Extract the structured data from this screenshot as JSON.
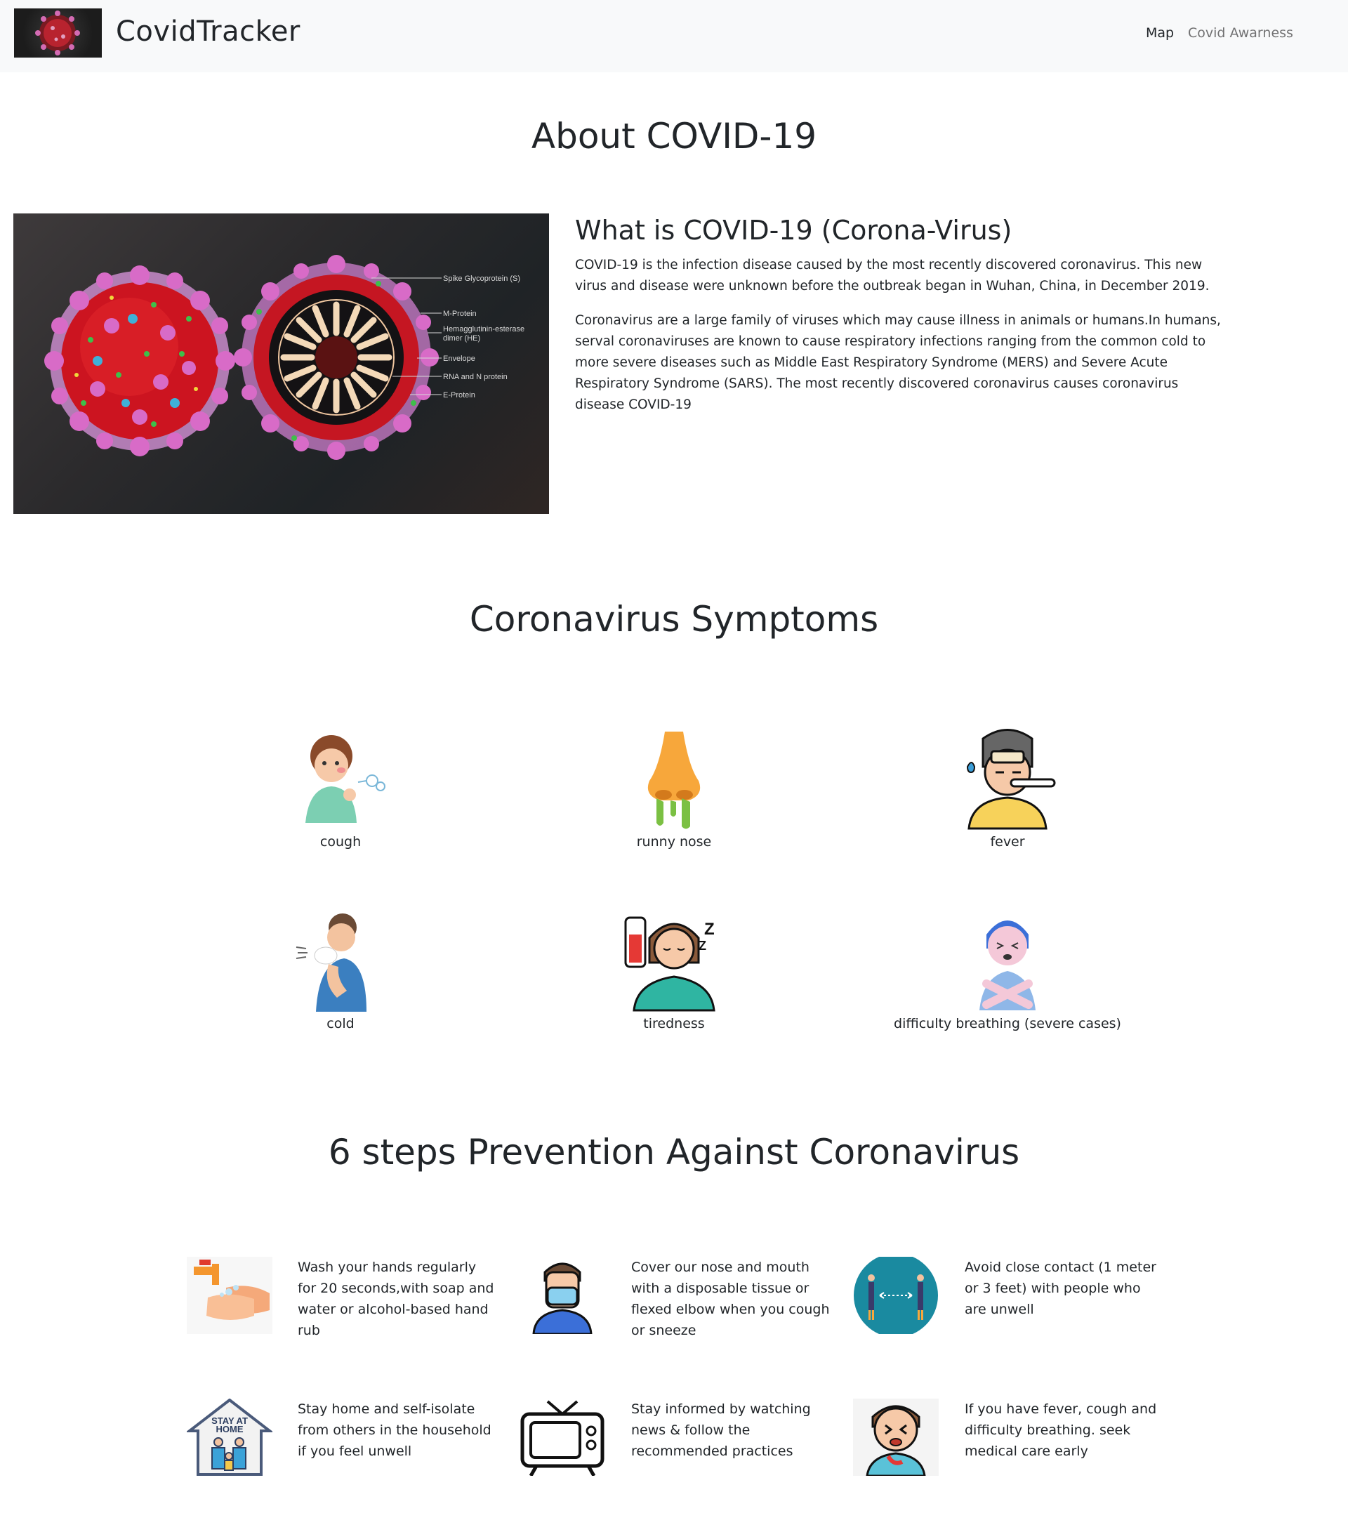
{
  "navbar": {
    "brand": "CovidTracker",
    "links": [
      {
        "label": "Map"
      },
      {
        "label": "Covid Awarness"
      }
    ]
  },
  "about": {
    "heading": "About COVID-19",
    "title": "What is COVID-19 (Corona-Virus)",
    "paragraph1": "COVID-19 is the infection disease caused by the most recently discovered coronavirus. This new virus and disease were unknown before the outbreak began in Wuhan, China, in December 2019.",
    "paragraph2": "Coronavirus are a large family of viruses which may cause illness in animals or humans.In humans, serval coronaviruses are known to cause respiratory infections ranging from the common cold to more severe diseases such as Middle East Respiratory Syndrome (MERS) and Severe Acute Respiratory Syndrome (SARS). The most recently discovered coronavirus causes coronavirus disease COVID-19",
    "image_labels": [
      "Spike Glycoprotein (S)",
      "M-Protein",
      "Hemagglutinin-esterase dimer (HE)",
      "Envelope",
      "RNA and N protein",
      "E-Protein"
    ]
  },
  "symptoms": {
    "heading": "Coronavirus Symptoms",
    "items": [
      {
        "label": "cough",
        "icon": "cough-icon"
      },
      {
        "label": "runny nose",
        "icon": "runny-nose-icon"
      },
      {
        "label": "fever",
        "icon": "fever-icon"
      },
      {
        "label": "cold",
        "icon": "cold-icon"
      },
      {
        "label": "tiredness",
        "icon": "tiredness-icon"
      },
      {
        "label": "difficulty breathing (severe cases)",
        "icon": "difficulty-breathing-icon"
      }
    ]
  },
  "prevention": {
    "heading": "6 steps Prevention Against Coronavirus",
    "items": [
      {
        "text": "Wash your hands regularly for 20 seconds,with soap and water or alcohol-based hand rub",
        "icon": "hand-wash-icon"
      },
      {
        "text": "Cover our nose and mouth with a disposable tissue or flexed elbow when you cough or sneeze",
        "icon": "face-mask-icon"
      },
      {
        "text": "Avoid close contact (1 meter or 3 feet) with people who are unwell",
        "icon": "social-distance-icon"
      },
      {
        "text": "Stay home and self-isolate from others in the household if you feel unwell",
        "icon": "stay-home-icon",
        "icon_text": "STAY AT HOME"
      },
      {
        "text": "Stay informed by watching news & follow the recommended practices",
        "icon": "television-icon"
      },
      {
        "text": "If you have fever, cough and difficulty breathing. seek medical care early",
        "icon": "sick-person-icon"
      }
    ]
  },
  "colors": {
    "navbar_bg": "#f8f9fa",
    "text": "#212529",
    "nav_muted": "rgba(0,0,0,0.55)",
    "virus_red": "#d1121c",
    "virus_pink": "#d86bc7"
  }
}
